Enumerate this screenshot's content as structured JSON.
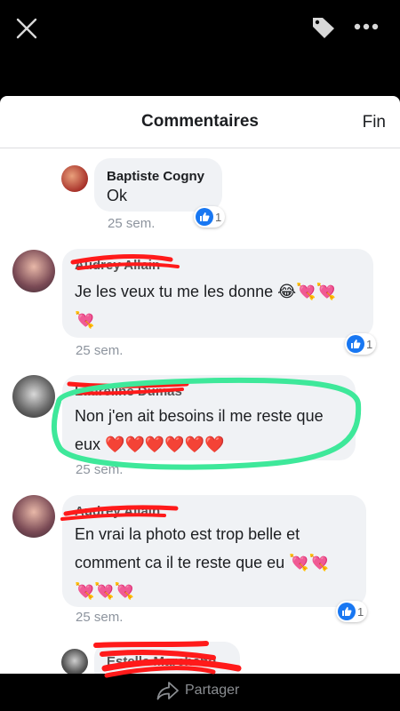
{
  "header": {
    "title": "Commentaires",
    "done_label": "Fin"
  },
  "comments": [
    {
      "name": "Baptiste Cogny",
      "text": "Ok",
      "time": "25 sem.",
      "likes": "1"
    },
    {
      "name": "Audrey Allain",
      "text": "Je les veux tu me les donne",
      "emojis": [
        "😂",
        "💘",
        "💘",
        "💘"
      ],
      "time": "25 sem.",
      "likes": "1"
    },
    {
      "name": "Lauréline Dumas",
      "text": "Non j'en ait besoins il me reste que",
      "text2": "eux",
      "emojis": [
        "❤️",
        "❤️",
        "❤️",
        "❤️",
        "❤️",
        "❤️"
      ],
      "time": "25 sem."
    },
    {
      "name": "Audrey Allain",
      "text": "En vrai la photo est trop belle et",
      "text2": "comment ca il te reste que eu",
      "emojis": [
        "💘",
        "💘"
      ],
      "emojis2": [
        "💘",
        "💘",
        "💘"
      ],
      "time": "25 sem.",
      "likes": "1"
    },
    {
      "name": "Estelle Marchand"
    }
  ],
  "bottom": {
    "share_label": "Partager"
  },
  "colors": {
    "like_blue": "#1877f2",
    "highlight_green": "#3ee89a",
    "redact_red": "#ff1a1a"
  },
  "icons": [
    "close-icon",
    "tag-icon",
    "more-icon",
    "like-icon",
    "share-icon"
  ]
}
